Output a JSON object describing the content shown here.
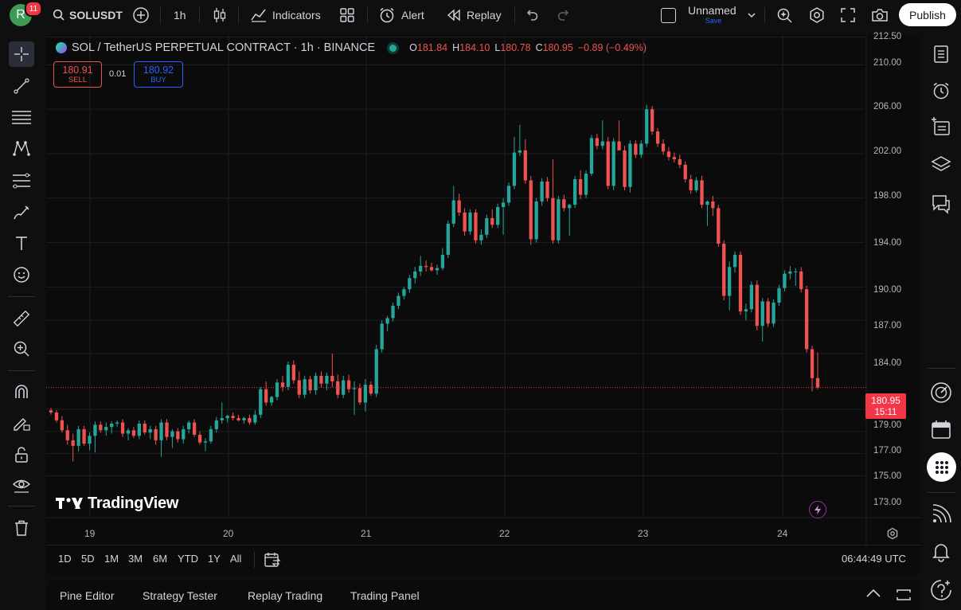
{
  "topbar": {
    "avatar_letter": "R",
    "notification_count": "11",
    "symbol": "SOLUSDT",
    "interval": "1h",
    "indicators_label": "Indicators",
    "alert_label": "Alert",
    "replay_label": "Replay",
    "layout_name": "Unnamed",
    "layout_save": "Save",
    "publish_label": "Publish"
  },
  "legend": {
    "title": "SOL / TetherUS PERPETUAL CONTRACT · 1h · BINANCE",
    "o_label": "O",
    "o_value": "181.84",
    "h_label": "H",
    "h_value": "184.10",
    "l_label": "L",
    "l_value": "180.78",
    "c_label": "C",
    "c_value": "180.95",
    "change": "−0.89 (−0.49%)"
  },
  "trade": {
    "sell_price": "180.91",
    "sell_label": "SELL",
    "spread": "0.01",
    "buy_price": "180.92",
    "buy_label": "BUY"
  },
  "watermark": "TradingView",
  "price_axis": {
    "labels": [
      "212.50",
      "210.00",
      "206.00",
      "202.00",
      "198.00",
      "194.00",
      "190.00",
      "187.00",
      "184.00",
      "179.00",
      "177.00",
      "175.00",
      "173.00"
    ],
    "current_price": "180.95",
    "countdown": "15:11"
  },
  "time_axis": {
    "labels": [
      "19",
      "20",
      "21",
      "22",
      "23",
      "24"
    ]
  },
  "timeframes": [
    "1D",
    "5D",
    "1M",
    "3M",
    "6M",
    "YTD",
    "1Y",
    "All"
  ],
  "clock": "06:44:49 UTC",
  "bottom_tabs": [
    "Pine Editor",
    "Strategy Tester",
    "Replay Trading",
    "Trading Panel"
  ],
  "colors": {
    "up": "#26a69a",
    "down": "#ef5350",
    "accent": "#2962ff",
    "background": "#0b0b0b"
  },
  "chart_data": {
    "type": "candlestick",
    "symbol": "SOL / TetherUS PERPETUAL CONTRACT",
    "interval": "1h",
    "exchange": "BINANCE",
    "ylim": [
      172,
      213
    ],
    "candles": [
      [
        178.9,
        179.1,
        178.5,
        178.7
      ],
      [
        178.7,
        178.9,
        177.8,
        178.0
      ],
      [
        178.0,
        178.4,
        176.9,
        177.1
      ],
      [
        177.1,
        177.6,
        175.8,
        176.2
      ],
      [
        176.2,
        176.8,
        174.3,
        175.7
      ],
      [
        175.7,
        177.5,
        175.2,
        177.2
      ],
      [
        177.2,
        177.5,
        175.7,
        175.9
      ],
      [
        175.9,
        176.9,
        175.3,
        176.6
      ],
      [
        176.6,
        177.9,
        175.1,
        177.6
      ],
      [
        177.6,
        177.9,
        176.9,
        177.1
      ],
      [
        177.1,
        177.8,
        176.6,
        177.4
      ],
      [
        177.4,
        177.9,
        176.8,
        177.7
      ],
      [
        177.7,
        178.0,
        177.4,
        177.8
      ],
      [
        177.8,
        178.1,
        176.5,
        176.8
      ],
      [
        176.8,
        177.3,
        176.2,
        177.1
      ],
      [
        177.1,
        177.4,
        176.4,
        176.6
      ],
      [
        176.6,
        178.0,
        176.3,
        177.7
      ],
      [
        177.7,
        178.0,
        176.7,
        176.9
      ],
      [
        176.9,
        177.5,
        176.3,
        177.2
      ],
      [
        177.2,
        177.5,
        175.8,
        176.2
      ],
      [
        176.2,
        178.1,
        174.7,
        177.8
      ],
      [
        177.8,
        178.1,
        176.2,
        176.5
      ],
      [
        176.5,
        177.2,
        175.5,
        177.0
      ],
      [
        177.0,
        177.3,
        176.0,
        176.3
      ],
      [
        176.3,
        177.5,
        175.9,
        177.2
      ],
      [
        177.2,
        178.0,
        176.8,
        177.8
      ],
      [
        177.8,
        178.1,
        176.5,
        176.7
      ],
      [
        176.7,
        177.0,
        175.8,
        176.0
      ],
      [
        176.0,
        176.4,
        175.2,
        176.1
      ],
      [
        176.1,
        177.5,
        175.9,
        177.2
      ],
      [
        177.2,
        178.3,
        176.9,
        178.0
      ],
      [
        178.0,
        179.6,
        177.7,
        178.2
      ],
      [
        178.2,
        178.5,
        177.8,
        178.4
      ],
      [
        178.4,
        178.7,
        178.0,
        178.2
      ],
      [
        178.2,
        178.5,
        177.9,
        178.0
      ],
      [
        178.0,
        178.3,
        177.7,
        178.2
      ],
      [
        178.2,
        178.5,
        177.6,
        177.8
      ],
      [
        177.8,
        178.9,
        177.6,
        178.5
      ],
      [
        178.5,
        181.0,
        178.2,
        180.8
      ],
      [
        180.8,
        181.5,
        179.3,
        179.6
      ],
      [
        179.6,
        180.2,
        179.3,
        180.1
      ],
      [
        180.1,
        181.7,
        179.8,
        181.4
      ],
      [
        181.4,
        182.0,
        180.6,
        181.0
      ],
      [
        181.0,
        183.3,
        180.7,
        183.0
      ],
      [
        183.0,
        183.4,
        181.3,
        181.6
      ],
      [
        181.6,
        182.4,
        180.0,
        180.3
      ],
      [
        180.3,
        182.0,
        180.0,
        181.7
      ],
      [
        181.7,
        182.0,
        180.4,
        180.7
      ],
      [
        180.7,
        182.3,
        180.3,
        182.0
      ],
      [
        182.0,
        182.4,
        181.0,
        181.3
      ],
      [
        181.3,
        182.3,
        180.7,
        182.0
      ],
      [
        182.0,
        184.0,
        181.0,
        181.5
      ],
      [
        181.5,
        182.1,
        180.0,
        180.3
      ],
      [
        180.3,
        182.0,
        180.0,
        181.6
      ],
      [
        181.6,
        182.1,
        180.5,
        180.8
      ],
      [
        180.8,
        181.5,
        178.5,
        180.9
      ],
      [
        180.9,
        181.3,
        179.4,
        179.6
      ],
      [
        179.6,
        181.7,
        178.8,
        181.2
      ],
      [
        181.2,
        181.5,
        180.2,
        180.4
      ],
      [
        180.4,
        184.8,
        180.1,
        184.4
      ],
      [
        184.4,
        187.0,
        184.1,
        186.7
      ],
      [
        186.7,
        187.4,
        186.0,
        187.2
      ],
      [
        187.2,
        188.6,
        186.9,
        188.3
      ],
      [
        188.3,
        189.5,
        188.0,
        189.2
      ],
      [
        189.2,
        190.0,
        188.9,
        189.8
      ],
      [
        189.8,
        191.1,
        189.5,
        190.8
      ],
      [
        190.8,
        191.8,
        190.3,
        191.4
      ],
      [
        191.4,
        192.8,
        191.0,
        191.9
      ],
      [
        191.9,
        192.4,
        191.4,
        191.8
      ],
      [
        191.8,
        192.2,
        191.4,
        191.5
      ],
      [
        191.5,
        192.0,
        191.1,
        191.7
      ],
      [
        191.7,
        193.5,
        191.5,
        192.9
      ],
      [
        192.9,
        196.0,
        192.6,
        195.7
      ],
      [
        195.7,
        199.1,
        195.4,
        197.8
      ],
      [
        197.8,
        198.4,
        196.4,
        196.7
      ],
      [
        196.7,
        197.1,
        194.6,
        195.0
      ],
      [
        195.0,
        197.0,
        194.7,
        196.7
      ],
      [
        196.7,
        197.0,
        193.9,
        194.2
      ],
      [
        194.2,
        195.2,
        193.8,
        194.7
      ],
      [
        194.7,
        196.5,
        194.4,
        196.2
      ],
      [
        196.2,
        197.0,
        195.3,
        195.6
      ],
      [
        195.6,
        197.5,
        195.3,
        197.2
      ],
      [
        197.2,
        198.0,
        194.7,
        197.6
      ],
      [
        197.6,
        199.4,
        197.3,
        199.1
      ],
      [
        199.1,
        203.5,
        198.8,
        202.1
      ],
      [
        202.1,
        204.6,
        201.8,
        202.3
      ],
      [
        202.3,
        203.3,
        199.3,
        199.6
      ],
      [
        199.6,
        200.0,
        193.8,
        194.3
      ],
      [
        194.3,
        198.0,
        194.0,
        197.7
      ],
      [
        197.7,
        199.8,
        197.3,
        199.5
      ],
      [
        199.5,
        199.9,
        197.7,
        198.0
      ],
      [
        198.0,
        201.5,
        193.9,
        194.2
      ],
      [
        194.2,
        198.2,
        193.9,
        197.9
      ],
      [
        197.9,
        198.3,
        196.8,
        197.1
      ],
      [
        197.1,
        197.5,
        194.6,
        197.4
      ],
      [
        197.4,
        200.0,
        197.1,
        199.7
      ],
      [
        199.7,
        200.5,
        197.9,
        198.3
      ],
      [
        198.3,
        200.5,
        198.0,
        200.2
      ],
      [
        200.2,
        203.7,
        200.0,
        203.4
      ],
      [
        203.4,
        203.8,
        202.4,
        202.7
      ],
      [
        202.7,
        205.0,
        202.4,
        203.1
      ],
      [
        203.1,
        203.5,
        198.8,
        199.1
      ],
      [
        199.1,
        203.4,
        198.7,
        203.1
      ],
      [
        203.1,
        205.0,
        202.7,
        202.3
      ],
      [
        202.3,
        202.7,
        198.7,
        199.0
      ],
      [
        199.0,
        203.2,
        198.5,
        202.9
      ],
      [
        202.9,
        203.2,
        201.6,
        201.9
      ],
      [
        201.9,
        203.2,
        201.6,
        202.9
      ],
      [
        202.9,
        206.4,
        202.6,
        206.0
      ],
      [
        206.0,
        206.3,
        203.7,
        204.0
      ],
      [
        204.0,
        204.3,
        202.6,
        202.9
      ],
      [
        202.9,
        203.3,
        201.9,
        202.2
      ],
      [
        202.2,
        202.6,
        201.4,
        201.7
      ],
      [
        201.7,
        202.1,
        201.2,
        201.5
      ],
      [
        201.5,
        201.9,
        200.7,
        201.0
      ],
      [
        201.0,
        201.3,
        199.4,
        199.7
      ],
      [
        199.7,
        200.1,
        198.4,
        198.7
      ],
      [
        198.7,
        199.9,
        198.5,
        199.6
      ],
      [
        199.6,
        200.0,
        197.1,
        197.4
      ],
      [
        197.4,
        197.8,
        195.5,
        197.7
      ],
      [
        197.7,
        198.2,
        196.4,
        197.1
      ],
      [
        197.1,
        197.4,
        193.6,
        193.9
      ],
      [
        193.9,
        194.2,
        188.8,
        189.2
      ],
      [
        189.2,
        192.3,
        187.9,
        191.8
      ],
      [
        191.8,
        193.2,
        191.3,
        192.9
      ],
      [
        192.9,
        193.2,
        187.5,
        187.8
      ],
      [
        187.8,
        188.5,
        187.0,
        188.0
      ],
      [
        188.0,
        190.5,
        187.7,
        190.2
      ],
      [
        190.2,
        190.6,
        186.1,
        186.5
      ],
      [
        186.5,
        189.0,
        185.1,
        188.7
      ],
      [
        188.7,
        189.0,
        186.4,
        186.7
      ],
      [
        186.7,
        188.9,
        186.4,
        188.6
      ],
      [
        188.6,
        190.2,
        188.3,
        189.9
      ],
      [
        189.9,
        191.5,
        189.6,
        191.2
      ],
      [
        191.2,
        191.9,
        190.7,
        191.4
      ],
      [
        191.4,
        191.7,
        190.1,
        191.4
      ],
      [
        191.4,
        191.8,
        189.5,
        189.8
      ],
      [
        189.8,
        190.1,
        184.1,
        184.4
      ],
      [
        184.4,
        184.7,
        180.6,
        181.8
      ],
      [
        181.8,
        184.1,
        180.8,
        180.95
      ]
    ]
  }
}
